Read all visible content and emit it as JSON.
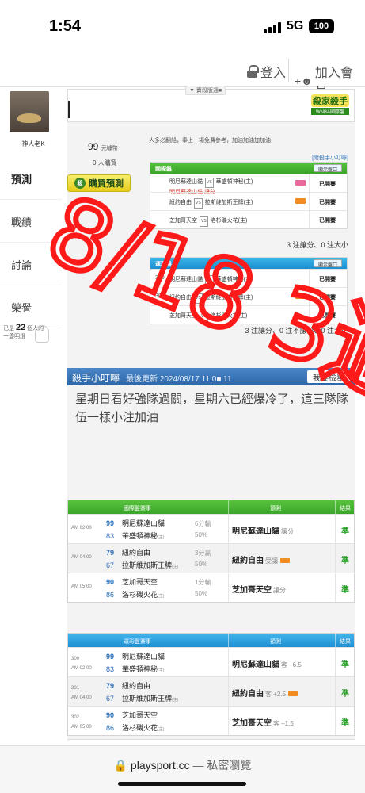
{
  "status_bar": {
    "time": "1:54",
    "network": "5G",
    "battery": "100"
  },
  "nav": {
    "login": "登入",
    "join": "加入會員"
  },
  "sidebar": {
    "user_name": "神人老K",
    "tabs": [
      "預測",
      "戰績",
      "討論",
      "榮譽"
    ],
    "active_tab": "預測",
    "count_prefix": "已是",
    "count": "22",
    "count_suffix": "個人的一盞明燈"
  },
  "banner": {
    "tag": "▼ 賣殺版通■",
    "logo_top": "殺家殺手",
    "logo_bottom": "WNBA國際盤"
  },
  "purchase": {
    "price": "99",
    "price_unit": "元噱幣",
    "buyers": "0 人購買",
    "button": "購買預測",
    "badge": "殺",
    "note": "人多必翻船，奉上一場免費參考，加油加油加加油",
    "attach": "[附殺手小叮嚀]"
  },
  "intl": {
    "title": "國際盤",
    "show": "顯示盤口",
    "rows": [
      {
        "home": "明尼蘇達山貓",
        "away": "華盛頓神秘(主)",
        "pick": "明尼蘇達山貓",
        "pick_type": "讓分",
        "status": "已開賽"
      },
      {
        "home": "紐約自由",
        "away": "拉斯維加斯王牌(主)",
        "pick": "",
        "pick_type": "",
        "status": "已開賽"
      },
      {
        "home": "芝加哥天空",
        "away": "洛杉磯火花(主)",
        "pick": "",
        "pick_type": "",
        "status": "已開賽"
      }
    ],
    "summary": "3 注讓分、0 注大小"
  },
  "lottery": {
    "title": "運彩盤",
    "show": "顯示盤口",
    "rows": [
      {
        "num": "300",
        "home": "明尼蘇達山貓",
        "away": "華盛頓神秘(主)",
        "status": "已開賽"
      },
      {
        "num": "301",
        "home": "紐約自由",
        "away": "拉斯維加斯王牌(主)",
        "status": "已開賽"
      },
      {
        "num": "",
        "home": "芝加哥天空",
        "away": "洛杉磯火花(主)",
        "status": "已開賽"
      }
    ],
    "summary": "3 注讓分、0 注不讓分、0 注大小"
  },
  "killer_tip": {
    "title": "殺手小叮嚀",
    "updated": "最後更新 2024/08/17 11:0■ 11",
    "report": "我要檢舉",
    "text": "星期日看好強隊過關，星期六已經爆冷了，這三隊隊伍一樣小注加油"
  },
  "intl_results": {
    "head_match": "國際盤賽事",
    "head_pred": "預測",
    "head_res": "結果",
    "rows": [
      {
        "time": "AM 02:00",
        "n1": "99",
        "t1": "明尼蘇達山貓",
        "n2": "83",
        "t2": "華盛頓神秘",
        "line1": "6分輸",
        "line2": "50%",
        "pred": "明尼蘇達山貓",
        "pred_type": "讓分",
        "res": "準"
      },
      {
        "time": "AM 04:00",
        "n1": "79",
        "t1": "紐約自由",
        "n2": "67",
        "t2": "拉斯維加斯王牌",
        "line1": "3分贏",
        "line2": "50%",
        "pred": "紐約自由",
        "pred_type": "受讓",
        "res": "準"
      },
      {
        "time": "AM 05:00",
        "n1": "90",
        "t1": "芝加哥天空",
        "n2": "86",
        "t2": "洛杉磯火花",
        "line1": "1分輸",
        "line2": "50%",
        "pred": "芝加哥天空",
        "pred_type": "讓分",
        "res": "準"
      }
    ]
  },
  "lottery_results": {
    "head_match": "運彩盤賽事",
    "head_pred": "預測",
    "head_res": "結果",
    "rows": [
      {
        "num": "300",
        "time": "AM 02:00",
        "n1": "99",
        "t1": "明尼蘇達山貓",
        "n2": "83",
        "t2": "華盛頓神秘",
        "pred": "明尼蘇達山貓",
        "pred_type": "客 –6.5",
        "res": "準"
      },
      {
        "num": "301",
        "time": "AM 04:00",
        "n1": "79",
        "t1": "紐約自由",
        "n2": "67",
        "t2": "拉斯維加斯王牌",
        "pred": "紐約自由",
        "pred_type": "客 +2.5",
        "res": "準"
      },
      {
        "num": "302",
        "time": "AM 05:00",
        "n1": "90",
        "t1": "芝加哥天空",
        "n2": "86",
        "t2": "洛杉磯火花",
        "pred": "芝加哥天空",
        "pred_type": "客 –1.5",
        "res": "準"
      }
    ]
  },
  "home_tag": "(主)",
  "safari": {
    "domain": "playsport.cc",
    "mode": "— 私密瀏覽"
  },
  "overlay_text": "8/18 3過3",
  "colors": {
    "green_head": "#3ba52a",
    "blue_head": "#1e8fd2",
    "overlay_red": "#ff1a1a",
    "result_green": "#2aa02a"
  }
}
